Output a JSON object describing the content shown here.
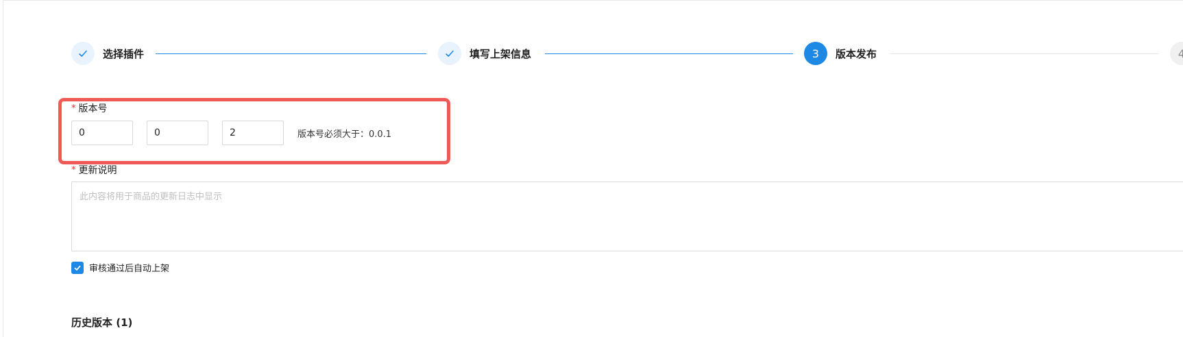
{
  "steps": [
    {
      "label": "选择插件",
      "state": "done",
      "icon": "check-icon"
    },
    {
      "label": "填写上架信息",
      "state": "done",
      "icon": "check-icon"
    },
    {
      "label": "版本发布",
      "state": "active",
      "number": "3"
    },
    {
      "label": "",
      "state": "next",
      "number": "4"
    }
  ],
  "version": {
    "label": "版本号",
    "required_mark": "*",
    "major": "0",
    "minor": "0",
    "patch": "2",
    "hint": "版本号必须大于：0.0.1"
  },
  "update_notes": {
    "label": "更新说明",
    "required_mark": "*",
    "placeholder": "此内容将用于商品的更新日志中显示"
  },
  "auto_publish": {
    "label": "审核通过后自动上架",
    "checked": true
  },
  "history": {
    "title": "历史版本 (1)"
  },
  "colors": {
    "primary": "#1e88e5",
    "highlight": "#f05a56",
    "required": "#f5222d"
  }
}
